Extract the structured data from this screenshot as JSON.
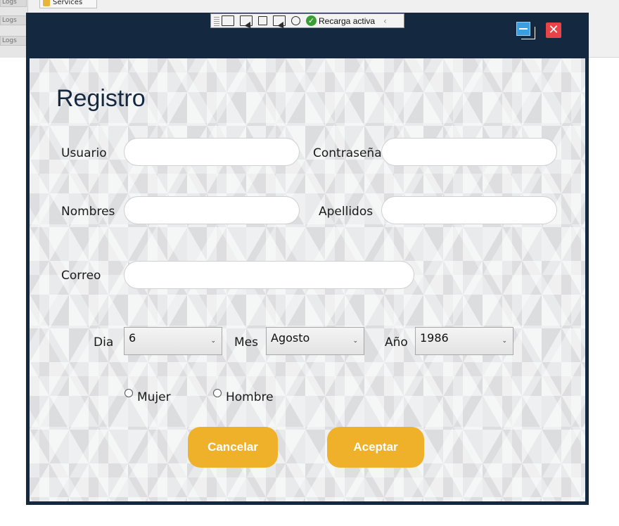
{
  "background": {
    "services_tab": "Services",
    "log_tabs": [
      "Logs",
      "Logs",
      "Logs"
    ]
  },
  "debug_toolbar": {
    "reload_label": "Recarga activa"
  },
  "window": {
    "minimize_label": "",
    "close_glyph": "✕"
  },
  "form": {
    "title": "Registro",
    "fields": {
      "usuario_label": "Usuario",
      "contrasena_label": "Contraseña",
      "nombres_label": "Nombres",
      "apellidos_label": "Apellidos",
      "correo_label": "Correo",
      "usuario_value": "",
      "contrasena_value": "",
      "nombres_value": "",
      "apellidos_value": "",
      "correo_value": ""
    },
    "date": {
      "dia_label": "Dia",
      "mes_label": "Mes",
      "anio_label": "Año",
      "dia_value": "6",
      "mes_value": "Agosto",
      "anio_value": "1986",
      "dropdown_glyph": "⌄"
    },
    "gender": {
      "mujer_label": "Mujer",
      "hombre_label": "Hombre"
    },
    "buttons": {
      "cancel_label": "Cancelar",
      "accept_label": "Aceptar"
    }
  },
  "colors": {
    "window_frame": "#142840",
    "accent_button": "#f0b12a",
    "close_button": "#e84448",
    "minimize_button": "#3a9ee0"
  }
}
